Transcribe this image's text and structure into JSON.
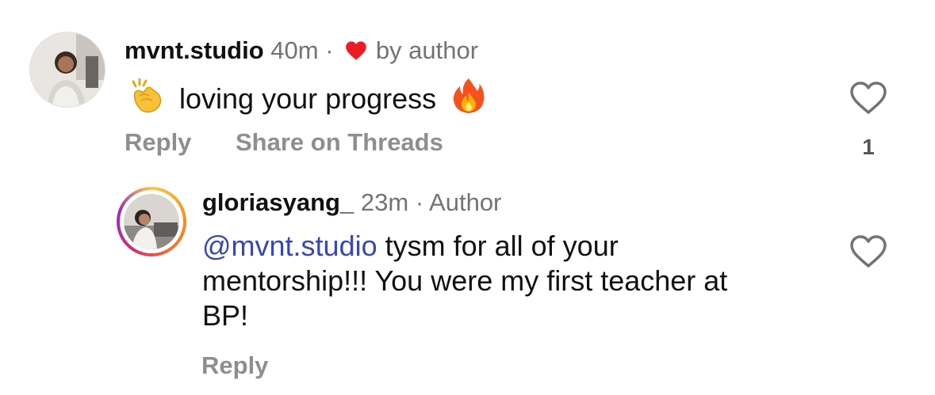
{
  "comments": [
    {
      "username": "mvnt.studio",
      "time": "40m",
      "separator": "·",
      "liked_by_author_label": "by author",
      "text": "loving your progress",
      "actions": {
        "reply": "Reply",
        "share": "Share on Threads"
      },
      "like_count": "1",
      "icons": [
        "clapping-hands-emoji",
        "fire-emoji",
        "red-heart-icon",
        "heart-outline-icon"
      ]
    },
    {
      "username": "gloriasyang_",
      "time": "23m",
      "separator": "·",
      "badge": "Author",
      "mention": "@mvnt.studio",
      "text_line1": " tysm for all of your",
      "text_line2": "mentorship!!! You were my first teacher at",
      "text_line3": "BP!",
      "actions": {
        "reply": "Reply"
      },
      "icons": [
        "heart-outline-icon"
      ]
    }
  ],
  "colors": {
    "mention": "#3949ab",
    "meta": "#737373",
    "action": "#8e8e8e",
    "heart_red": "#ed1c24"
  }
}
